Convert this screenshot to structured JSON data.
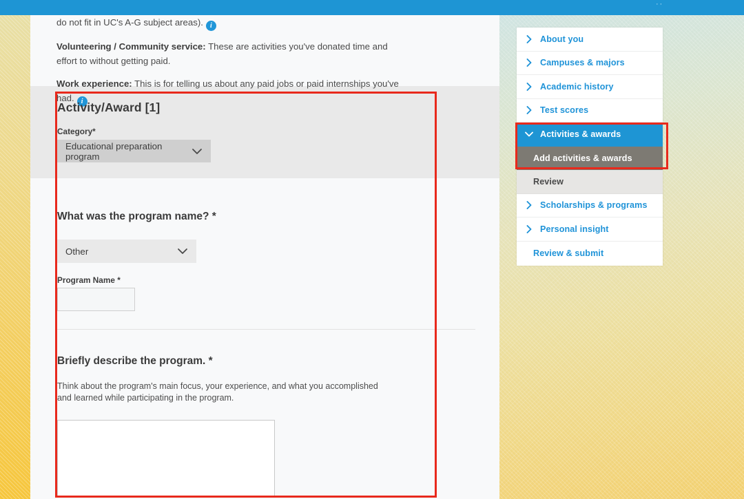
{
  "topbar": {
    "glyph": "··"
  },
  "intro": {
    "line1": "do not fit in UC's A-G subject areas).",
    "vol_label": "Volunteering / Community service:",
    "vol_text": " These are activities you've donated time and effort to without getting paid.",
    "work_label": "Work experience:",
    "work_text": " This is for telling us about any paid jobs or paid internships you've had.",
    "info_glyph": "i"
  },
  "form": {
    "section_title": "Activity/Award [1]",
    "category_label": "Category*",
    "category_value": "Educational preparation program",
    "program_question": "What was the program name? *",
    "program_value": "Other",
    "program_name_label": "Program Name *",
    "program_name_value": "",
    "describe_question": "Briefly describe the program. *",
    "describe_helper": "Think about the program's main focus, your experience, and what you accomplished and learned while participating in the program.",
    "describe_value": ""
  },
  "sidebar": {
    "items": [
      {
        "label": "About you",
        "chevron": "right",
        "state": "link"
      },
      {
        "label": "Campuses & majors",
        "chevron": "right",
        "state": "link"
      },
      {
        "label": "Academic history",
        "chevron": "right",
        "state": "link"
      },
      {
        "label": "Test scores",
        "chevron": "right",
        "state": "link"
      },
      {
        "label": "Activities & awards",
        "chevron": "down",
        "state": "active"
      },
      {
        "label": "Add activities & awards",
        "chevron": "none",
        "state": "sub-selected"
      },
      {
        "label": "Review",
        "chevron": "none",
        "state": "sub"
      },
      {
        "label": "Scholarships & programs",
        "chevron": "right",
        "state": "link"
      },
      {
        "label": "Personal insight",
        "chevron": "right",
        "state": "link"
      },
      {
        "label": "Review & submit",
        "chevron": "none",
        "state": "link"
      }
    ]
  },
  "colors": {
    "brand_blue": "#1e95d4",
    "link_blue": "#1f93d8",
    "annotation_red": "#e8291c",
    "sub_gray": "#7d7a73",
    "band_gray": "#e9e9e9",
    "gold": "#f3cf63"
  }
}
